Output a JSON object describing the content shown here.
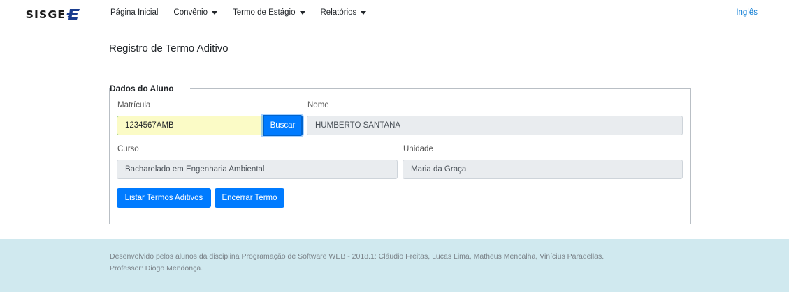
{
  "brand": {
    "logo_text": "SISGE",
    "logo_mark": "E"
  },
  "nav": {
    "items": [
      {
        "label": "Página Inicial",
        "dropdown": false
      },
      {
        "label": "Convênio",
        "dropdown": true
      },
      {
        "label": "Termo de Estágio",
        "dropdown": true
      },
      {
        "label": "Relatórios",
        "dropdown": true
      }
    ],
    "language_link": "Inglês"
  },
  "page": {
    "title": "Registro de Termo Aditivo"
  },
  "form": {
    "legend": "Dados do Aluno",
    "matricula": {
      "label": "Matrícula",
      "value": "1234567AMB"
    },
    "buscar_button": "Buscar",
    "nome": {
      "label": "Nome",
      "value": "HUMBERTO SANTANA"
    },
    "curso": {
      "label": "Curso",
      "value": "Bacharelado em Engenharia Ambiental"
    },
    "unidade": {
      "label": "Unidade",
      "value": "Maria da Graça"
    },
    "listar_button": "Listar Termos Aditivos",
    "encerrar_button": "Encerrar Termo"
  },
  "footer": {
    "credits": "Desenvolvido pelos alunos da disciplina Programação de Software WEB - 2018.1: Cláudio Freitas, Lucas Lima, Matheus Mencalha, Vinícius Paradellas.",
    "professor": "Professor: Diogo Mendonça."
  },
  "colors": {
    "primary": "#007bff",
    "link": "#0c7cd5",
    "footer_bg": "#d0e9ef",
    "active_input_bg": "#fbfbc6"
  }
}
